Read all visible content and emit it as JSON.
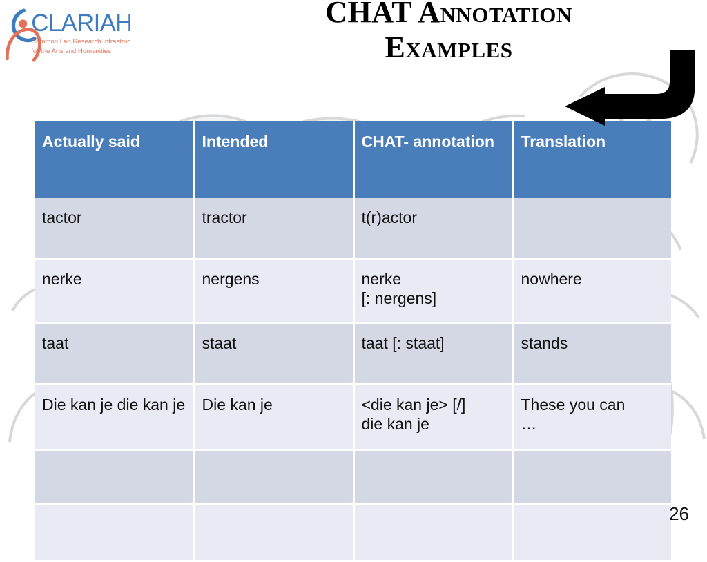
{
  "slide": {
    "title_lines": [
      "CHAT Annotation",
      "Examples"
    ],
    "page_number": "26",
    "accent_header_color": "#4A7EBB",
    "row_dark_color": "#D4D8E4",
    "row_light_color": "#E8EBF3"
  },
  "logo": {
    "wordmark": "CLARIAH",
    "tagline_line1": "Common Lab Research Infrastructure",
    "tagline_line2": "for the Arts and Humanities",
    "wordmark_color": "#3E7CC0",
    "tagline_color": "#E2725B"
  },
  "arrow": {
    "name": "return-arrow",
    "color": "#000000"
  },
  "table": {
    "headers": [
      "Actually said",
      "Intended",
      "CHAT-\nannotation",
      "Translation"
    ],
    "rows": [
      [
        "tactor",
        "tractor",
        "t(r)actor",
        ""
      ],
      [
        "nerke",
        "nergens",
        "nerke\n [: nergens]",
        "nowhere"
      ],
      [
        "taat",
        "staat",
        "taat [: staat]",
        "stands"
      ],
      [
        "Die kan je die kan je",
        "Die kan je",
        "<die kan je> [/]\ndie kan je",
        "These you can\n…"
      ],
      [
        "",
        "",
        "",
        ""
      ],
      [
        "",
        "",
        "",
        ""
      ]
    ]
  }
}
